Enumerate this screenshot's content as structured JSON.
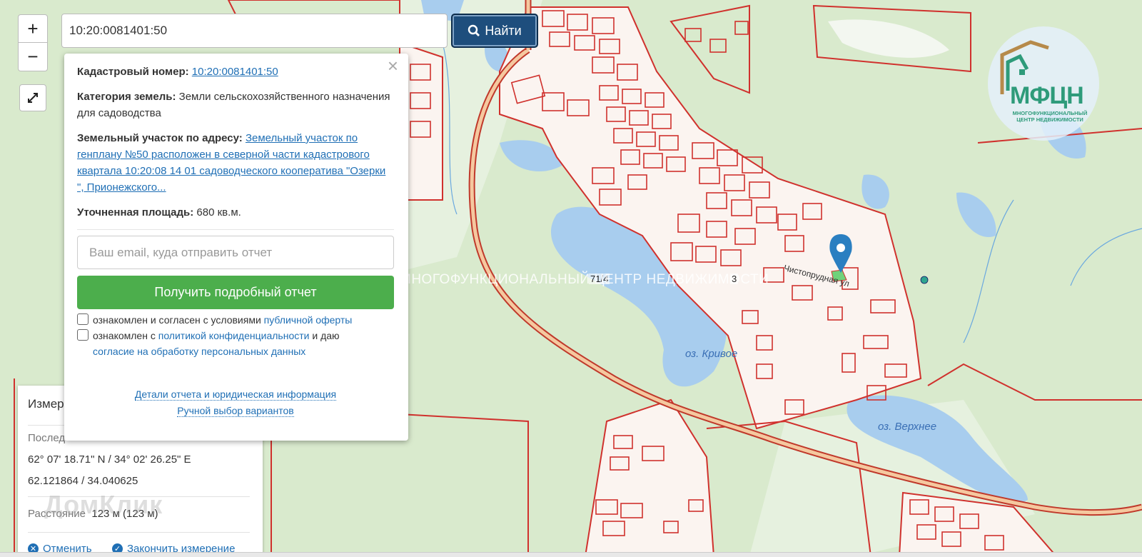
{
  "search": {
    "value": "10:20:0081401:50",
    "button_label": "Найти"
  },
  "zoom": {
    "in_label": "+",
    "out_label": "−"
  },
  "popup": {
    "cadastral_label": "Кадастровый номер:",
    "cadastral_value": "10:20:0081401:50",
    "category_label": "Категория земель:",
    "category_value": "Земли сельскохозяйственного назначения",
    "category_use": "для садоводства",
    "address_label": "Земельный участок по адресу:",
    "address_value": "Земельный участок по генплану №50 расположен в северной части кадастрового квартала 10:20:08 14 01 садоводческого кооператива \"Озерки \", Прионежского...",
    "area_label": "Уточненная площадь:",
    "area_value": "680 кв.м.",
    "email_placeholder": "Ваш email, куда отправить отчет",
    "report_button": "Получить подробный отчет",
    "consent1_text": "ознакомлен и согласен с условиями",
    "consent1_link": "публичной оферты",
    "consent2_text": "ознакомлен с",
    "consent2_link": "политикой конфиденциальности",
    "consent2_tail": "и даю",
    "consent2_link2": "согласие на обработку персональных данных",
    "details_link": "Детали отчета и юридическая информация",
    "manual_link": "Ручной выбор вариантов"
  },
  "measure": {
    "title": "Измер",
    "last_label": "Послед",
    "coords_dms": "62° 07' 18.71\" N / 34° 02' 26.25\" E",
    "coords_dec": "62.121864 / 34.040625",
    "distance_label": "Расстояние",
    "distance_value": "123 м (123 м)",
    "cancel": "Отменить",
    "finish": "Закончить измерение"
  },
  "map_labels": {
    "lake1": "оз. Кривое",
    "lake2": "оз. Верхнее",
    "street": "Чистопрудная ул",
    "plot_71_4": "71/4",
    "plot_3": "3",
    "watermark": "МНОГОФУНКЦИОНАЛЬНЫЙ ЦЕНТР НЕДВИЖИМОСТИ",
    "domclick": "ДомКлик"
  },
  "logo": {
    "title": "МФЦН",
    "subtitle": "МНОГОФУНКЦИОНАЛЬНЫЙ ЦЕНТР НЕДВИЖИМОСТИ"
  },
  "colors": {
    "parcel_border": "#d0312d",
    "water": "#a8cdee",
    "forest": "#d9eacd",
    "settlement": "#fbf4f0",
    "marker": "#2a7fc1"
  }
}
